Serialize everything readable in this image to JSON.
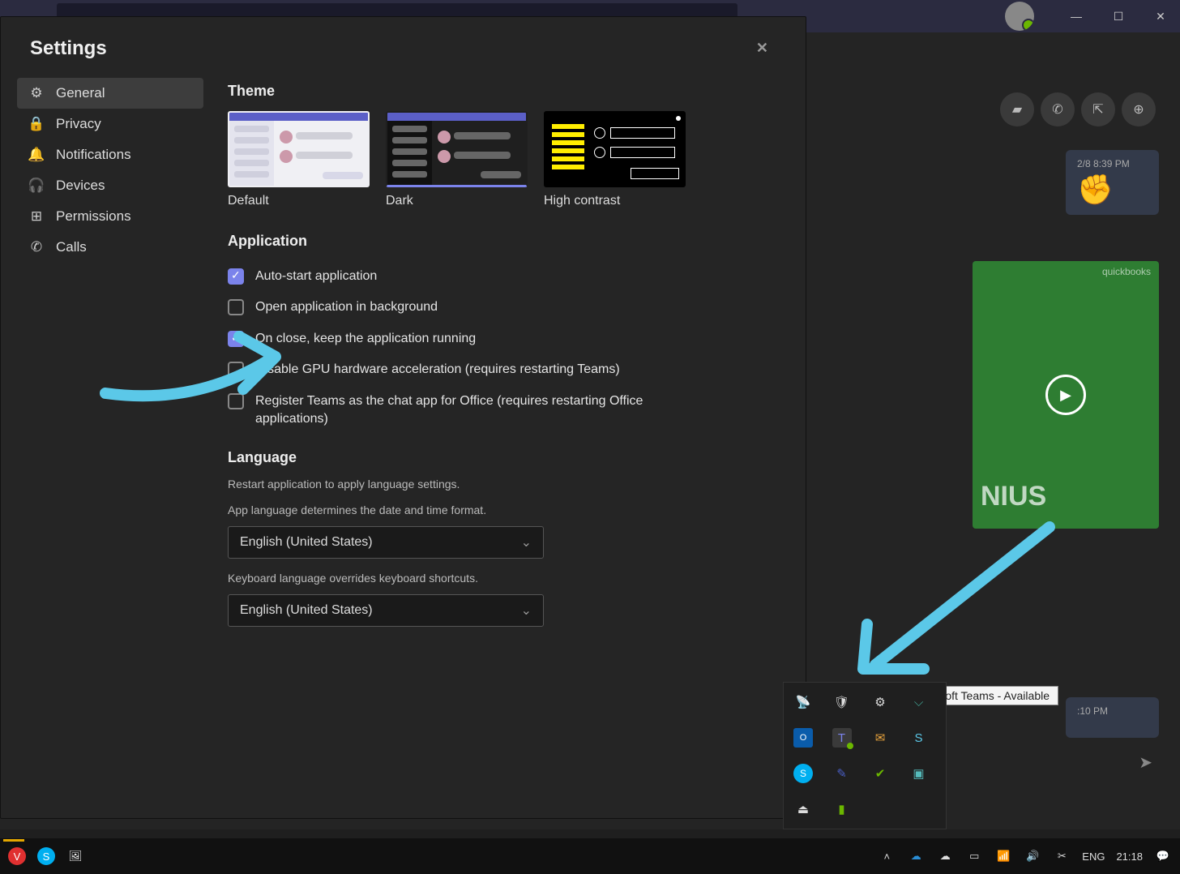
{
  "settings": {
    "title": "Settings",
    "sidebar": [
      {
        "icon": "gear",
        "label": "General",
        "active": true
      },
      {
        "icon": "lock",
        "label": "Privacy",
        "active": false
      },
      {
        "icon": "bell",
        "label": "Notifications",
        "active": false
      },
      {
        "icon": "headset",
        "label": "Devices",
        "active": false
      },
      {
        "icon": "grid",
        "label": "Permissions",
        "active": false
      },
      {
        "icon": "phone",
        "label": "Calls",
        "active": false
      }
    ],
    "theme": {
      "title": "Theme",
      "options": [
        {
          "label": "Default",
          "selected": false
        },
        {
          "label": "Dark",
          "selected": true
        },
        {
          "label": "High contrast",
          "selected": false
        }
      ]
    },
    "application": {
      "title": "Application",
      "options": [
        {
          "label": "Auto-start application",
          "checked": true
        },
        {
          "label": "Open application in background",
          "checked": false
        },
        {
          "label": "On close, keep the application running",
          "checked": true
        },
        {
          "label": "Disable GPU hardware acceleration (requires restarting Teams)",
          "checked": false
        },
        {
          "label": "Register Teams as the chat app for Office (requires restarting Office applications)",
          "checked": false
        }
      ]
    },
    "language": {
      "title": "Language",
      "restart_note": "Restart application to apply language settings.",
      "app_lang_note": "App language determines the date and time format.",
      "app_lang_value": "English (United States)",
      "kb_note": "Keyboard language overrides keyboard shortcuts.",
      "kb_value": "English (United States)"
    }
  },
  "chat": {
    "timestamp1": "2/8 8:39 PM",
    "emoji": "✊",
    "timestamp2": ":10 PM",
    "video_caption": "NIUS",
    "video_tag": "quickbooks"
  },
  "tray": {
    "tooltip": "Microsoft Teams - Available",
    "icons": [
      "broadcast",
      "shield",
      "gear-small",
      "bluetooth",
      "outlook",
      "teams",
      "mail",
      "skype-biz",
      "skype",
      "pen",
      "check",
      "device",
      "usb",
      "battery"
    ]
  },
  "taskbar": {
    "left": [
      "vivaldi",
      "skype",
      "photos"
    ],
    "lang": "ENG",
    "time": "21:18"
  }
}
